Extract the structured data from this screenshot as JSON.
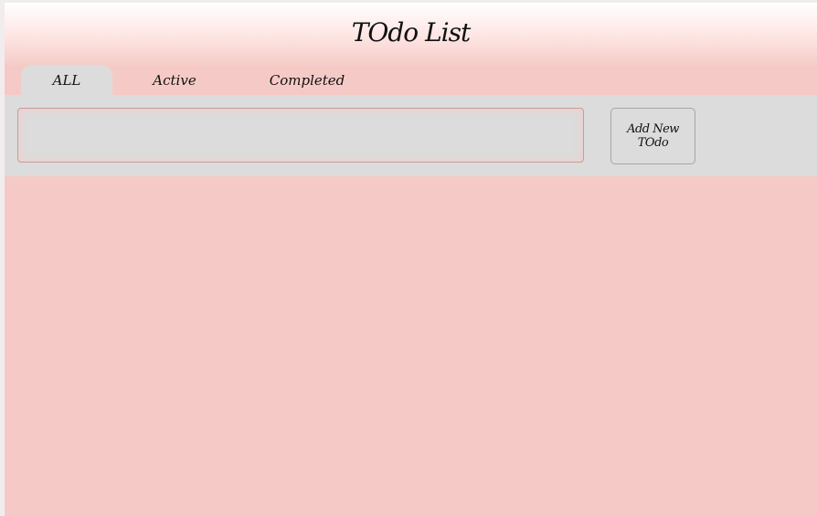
{
  "header": {
    "title": "TOdo List"
  },
  "tabs": [
    {
      "label": "ALL",
      "active": true
    },
    {
      "label": "Active",
      "active": false
    },
    {
      "label": "Completed",
      "active": false
    }
  ],
  "form": {
    "input_value": "",
    "input_placeholder": "",
    "add_button_label": "Add New TOdo"
  },
  "colors": {
    "background": "#f5cac6",
    "panel": "#dcdcdc",
    "text": "#111111"
  }
}
